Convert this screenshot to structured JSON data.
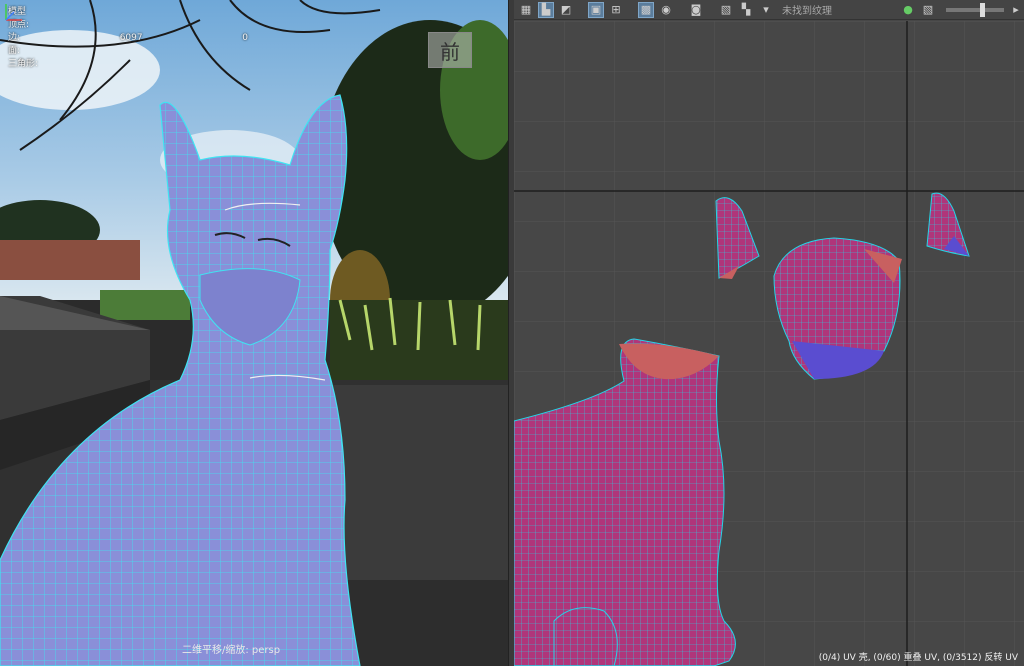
{
  "viewport": {
    "hud_rows": [
      {
        "label": "模型",
        "value": "",
        "extra": ""
      },
      {
        "label": "顶点:",
        "value": "",
        "extra": ""
      },
      {
        "label": "边:",
        "value": "6097",
        "extra": "0"
      },
      {
        "label": "面:",
        "value": "",
        "extra": ""
      },
      {
        "label": "三角形:",
        "value": "",
        "extra": ""
      }
    ],
    "viewcube_label": "前",
    "camera_label": "二维平移/缩放: persp",
    "mesh_color": "#8a8fd8",
    "wire_color": "#2fe0ee"
  },
  "uv_editor": {
    "toolbar_icons": [
      "uv-shell-icon",
      "uv-select-icon",
      "uv-flip-icon",
      "grid-icon",
      "grid-lines-icon",
      "checker-grid-icon",
      "sphere-icon",
      "snapshot-icon",
      "image-icon",
      "checker-icon",
      "dropdown-icon"
    ],
    "texture_label": "未找到纹理",
    "right_icons": [
      "rgb-icon",
      "image-toggle-icon",
      "exposure-slider",
      "forward-icon"
    ],
    "exposure_level": 0.62,
    "status_text": "(0/4) UV 壳, (0/60) 重叠 UV, (0/3512) 反转 UV",
    "shell_fill": "#b0357a",
    "shell_wire": "#23d6e8",
    "flipped_fill": "#5a4dd0",
    "cut_fill": "#c86060"
  }
}
